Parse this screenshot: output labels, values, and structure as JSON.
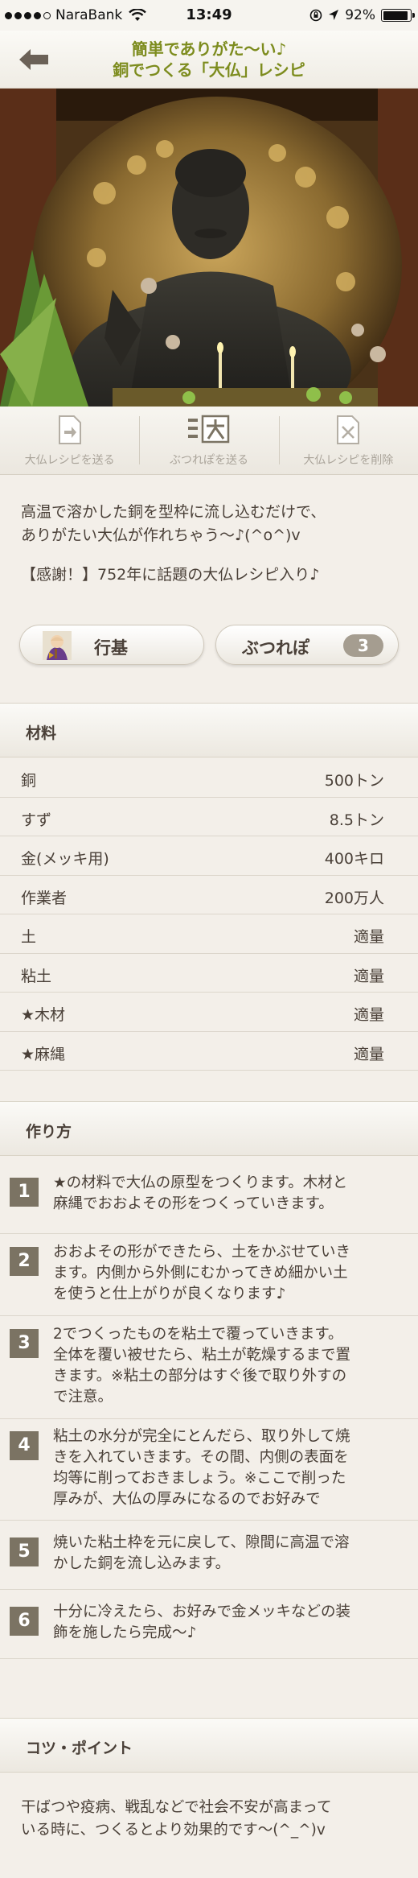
{
  "status_bar": {
    "carrier": "NaraBank",
    "time": "13:49",
    "battery_percent": "92%",
    "battery_level": 0.92
  },
  "nav": {
    "title_line1": "簡単でありがた〜い♪",
    "title_line2": "銅でつくる「大仏」レシピ",
    "back_icon": "back-arrow-icon"
  },
  "actions": [
    {
      "label": "大仏レシピを送る",
      "icon": "send-document-icon"
    },
    {
      "label": "ぶつれぽを送る",
      "icon": "tsukurepo-icon"
    },
    {
      "label": "大仏レシピを削除",
      "icon": "delete-document-icon"
    }
  ],
  "description": {
    "line1": "高温で溶かした銅を型枠に流し込むだけで、",
    "line2": "ありがたい大仏が作れちゃう〜♪(^o^)v",
    "thanks": "【感謝！】752年に話題の大仏レシピ入り♪"
  },
  "author": {
    "name": "行基"
  },
  "tsukurepo": {
    "label": "ぶつれぽ",
    "count": "3"
  },
  "ingredients_header": "材料",
  "ingredients": [
    {
      "name": "銅",
      "qty": "500トン"
    },
    {
      "name": "すず",
      "qty": "8.5トン"
    },
    {
      "name": "金(メッキ用)",
      "qty": "400キロ"
    },
    {
      "name": "作業者",
      "qty": "200万人"
    },
    {
      "name": "土",
      "qty": "適量"
    },
    {
      "name": "粘土",
      "qty": "適量"
    },
    {
      "name": "★木材",
      "qty": "適量"
    },
    {
      "name": "★麻縄",
      "qty": "適量"
    }
  ],
  "steps_header": "作り方",
  "steps": [
    {
      "num": "1",
      "line1": "★の材料で大仏の原型をつくります。木材と",
      "line2": "麻縄でおおよその形をつくっていきます。",
      "line3": ""
    },
    {
      "num": "2",
      "line1": "おおよその形ができたら、土をかぶせていき",
      "line2": "ます。内側から外側にむかってきめ細かい土",
      "line3": "を使うと仕上がりが良くなります♪"
    },
    {
      "num": "3",
      "line1": "2でつくったものを粘土で覆っていきます。",
      "line2": "全体を覆い被せたら、粘土が乾燥するまで置",
      "line3": "きます。※粘土の部分はすぐ後で取り外すの",
      "line4": "で注意。"
    },
    {
      "num": "4",
      "line1": "粘土の水分が完全にとんだら、取り外して焼",
      "line2": "きを入れていきます。その間、内側の表面を",
      "line3": "均等に削っておきましょう。※ここで削った",
      "line4": "厚みが、大仏の厚みになるのでお好みで"
    },
    {
      "num": "5",
      "line1": "焼いた粘土枠を元に戻して、隙間に高温で溶",
      "line2": "かした銅を流し込みます。",
      "line3": ""
    },
    {
      "num": "6",
      "line1": "十分に冷えたら、お好みで金メッキなどの装",
      "line2": "飾を施したら完成〜♪",
      "line3": ""
    }
  ],
  "tips_header": "コツ・ポイント",
  "tips": {
    "line1": "干ばつや疫病、戦乱などで社会不安が高まって",
    "line2": "いる時に、つくるとより効果的です〜(^_^)v"
  },
  "colors": {
    "title_green": "#7d8c1e",
    "badge_gray": "#a59d90",
    "step_number_bg": "#7b7363",
    "background": "#f3efe9"
  }
}
